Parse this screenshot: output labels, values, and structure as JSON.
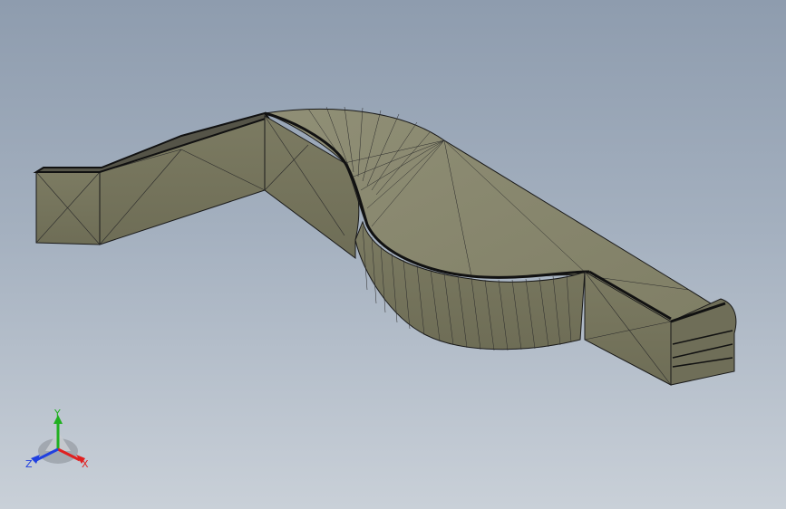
{
  "viewport": {
    "background_top": "#8e9cae",
    "background_bottom": "#c9d0d8"
  },
  "model": {
    "face_color": "#8b8a70",
    "side_color": "#7a795f",
    "edge_color": "#1a1a1a"
  },
  "triad": {
    "x_label": "X",
    "y_label": "Y",
    "z_label": "Z",
    "x_color": "#e02020",
    "y_color": "#20b020",
    "z_color": "#2040e0"
  }
}
